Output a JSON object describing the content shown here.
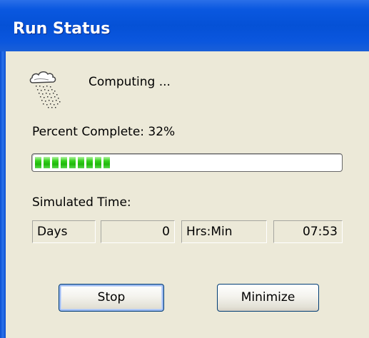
{
  "window": {
    "title": "Run Status"
  },
  "status": {
    "icon": "rain-cloud-icon",
    "text": "Computing ..."
  },
  "progress": {
    "label": "Percent Complete:  32%",
    "percent": 32,
    "blocks_shown": 9,
    "fill_color": "#2cc418"
  },
  "simulated_time": {
    "label": "Simulated Time:",
    "days_label": "Days",
    "days_value": "0",
    "hrsmin_label": "Hrs:Min",
    "hrsmin_value": "07:53"
  },
  "buttons": {
    "stop": "Stop",
    "minimize": "Minimize"
  },
  "colors": {
    "titlebar": "#0551d6",
    "client_bg": "#ece9d8"
  }
}
